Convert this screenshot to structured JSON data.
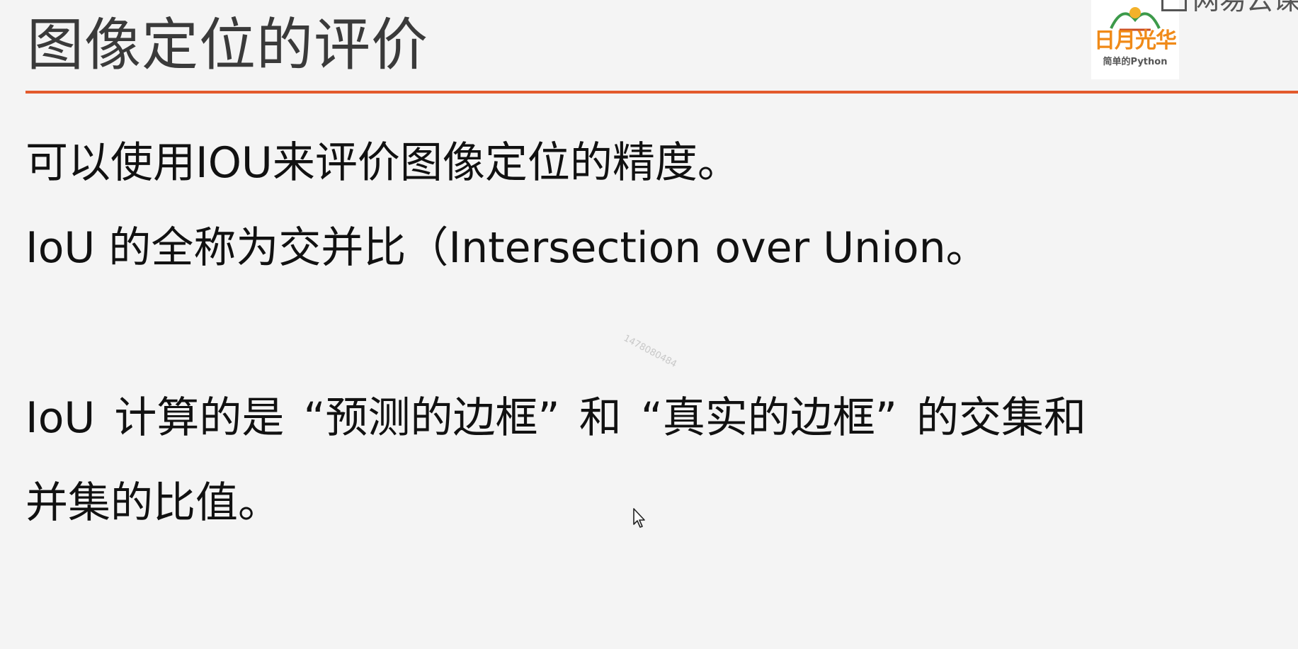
{
  "slide": {
    "title": "图像定位的评价",
    "lines": [
      "可以使用IOU来评价图像定位的精度。",
      "IoU 的全称为交并比（Intersection over Union。",
      "IoU 计算的是 “预测的边框” 和 “真实的边框” 的交集和",
      "并集的比值。"
    ],
    "watermark": "1478080484"
  },
  "logo": {
    "main_text": "日月光华",
    "sub_text": "简单的Python"
  },
  "brand": {
    "text": "网易云课堂"
  },
  "colors": {
    "accent_rule": "#e35a2c",
    "logo_orange": "#f08a18",
    "background": "#f4f4f4"
  },
  "icons": {
    "cursor": "mouse-pointer-icon",
    "brand": "netease-cloud-classroom-icon"
  }
}
